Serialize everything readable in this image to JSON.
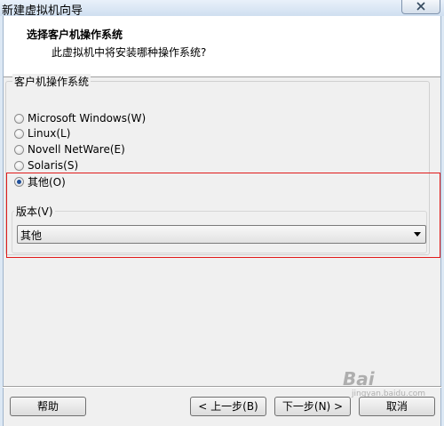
{
  "window": {
    "title": "新建虚拟机向导"
  },
  "header": {
    "title": "选择客户机操作系统",
    "subtitle": "此虚拟机中将安装哪种操作系统?"
  },
  "os_group": {
    "label": "客户机操作系统",
    "options": [
      {
        "label": "Microsoft Windows(W)",
        "checked": false
      },
      {
        "label": "Linux(L)",
        "checked": false
      },
      {
        "label": "Novell NetWare(E)",
        "checked": false
      },
      {
        "label": "Solaris(S)",
        "checked": false
      },
      {
        "label": "其他(O)",
        "checked": true
      }
    ]
  },
  "version": {
    "label": "版本(V)",
    "selected": "其他"
  },
  "buttons": {
    "help": "帮助",
    "back": "< 上一步(B)",
    "next": "下一步(N) >",
    "cancel": "取消"
  },
  "watermark": {
    "text": "Bai",
    "sub": "jingyan.baidu.com"
  },
  "colors": {
    "highlight": "#e01b1b",
    "radio_checked": "#1f4f9a"
  }
}
